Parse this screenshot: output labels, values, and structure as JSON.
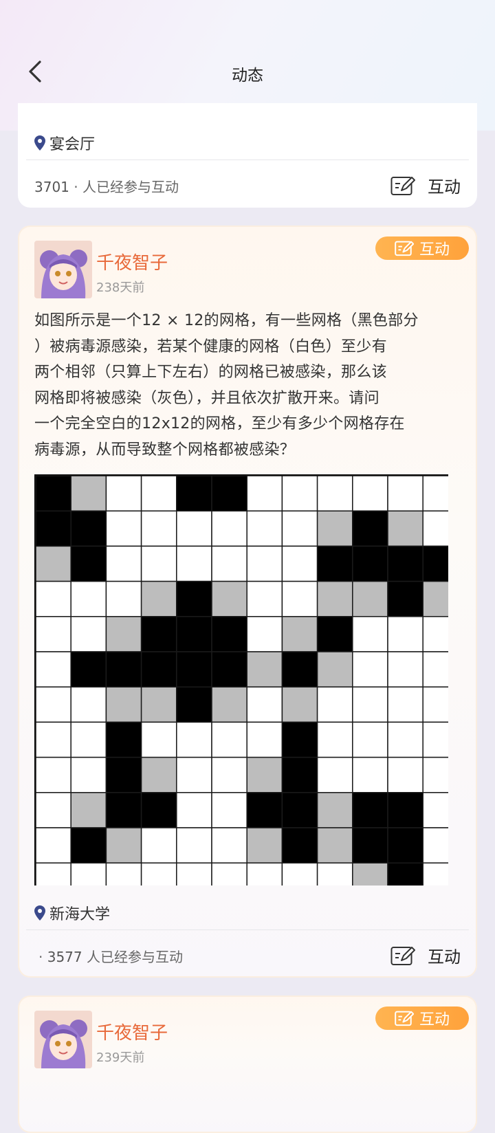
{
  "nav": {
    "title": "动态"
  },
  "card1": {
    "location": "宴会厅",
    "count": "3701",
    "count_suffix": "· 人已经参与互动",
    "interact_label": "互动"
  },
  "card2": {
    "author": "千夜智子",
    "time": "238天前",
    "badge_label": "互动",
    "lines": [
      "如图所示是一个12 × 12的网格，有一些网格（黑色部分",
      "）被病毒源感染，若某个健康的网格（白色）至少有",
      "两个相邻（只算上下左右）的网格已被感染，那么该",
      "网格即将被感染（灰色），并且依次扩散开来。请问",
      "一个完全空白的12x12的网格，至少有多少个网格存在",
      "病毒源，从而导致整个网格都被感染？"
    ],
    "grid": [
      [
        2,
        1,
        0,
        0,
        2,
        2,
        0,
        0,
        0,
        0,
        0,
        0
      ],
      [
        2,
        2,
        0,
        0,
        0,
        0,
        0,
        0,
        1,
        2,
        1,
        0
      ],
      [
        1,
        2,
        0,
        0,
        0,
        0,
        0,
        0,
        2,
        2,
        2,
        2
      ],
      [
        0,
        0,
        0,
        1,
        2,
        1,
        0,
        0,
        1,
        1,
        2,
        1
      ],
      [
        0,
        0,
        1,
        2,
        2,
        2,
        0,
        1,
        2,
        0,
        0,
        0
      ],
      [
        0,
        2,
        2,
        2,
        2,
        2,
        1,
        2,
        1,
        0,
        0,
        0
      ],
      [
        0,
        0,
        1,
        1,
        2,
        1,
        0,
        1,
        0,
        0,
        0,
        0
      ],
      [
        0,
        0,
        2,
        0,
        0,
        0,
        0,
        2,
        0,
        0,
        0,
        0
      ],
      [
        0,
        0,
        2,
        1,
        0,
        0,
        1,
        2,
        0,
        0,
        0,
        0
      ],
      [
        0,
        1,
        2,
        2,
        0,
        0,
        2,
        2,
        1,
        2,
        2,
        0
      ],
      [
        0,
        2,
        1,
        0,
        0,
        0,
        1,
        2,
        1,
        2,
        2,
        0
      ],
      [
        0,
        0,
        0,
        0,
        0,
        0,
        0,
        0,
        0,
        1,
        2,
        0
      ]
    ],
    "location": "新海大学",
    "count_prefix": "·",
    "count": "3577",
    "count_suffix": "人已经参与互动",
    "interact_label": "互动"
  },
  "card3": {
    "author": "千夜智子",
    "time": "239天前",
    "badge_label": "互动"
  },
  "icons": {
    "back": "chevron-left-icon",
    "location": "location-pin-icon",
    "interact": "edit-note-icon"
  },
  "colors": {
    "accent_orange": "#e8693a",
    "badge": "#ffa23b",
    "pin": "#3b4a8c"
  }
}
